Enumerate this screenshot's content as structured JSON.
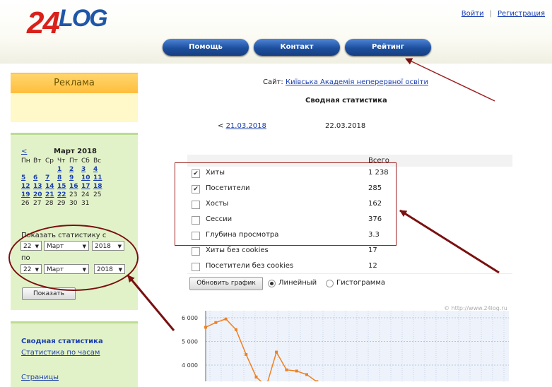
{
  "header": {
    "logo_digits": "24",
    "logo_text": "LOG",
    "login": "Войти",
    "separator": "|",
    "register": "Регистрация",
    "nav": [
      "Помощь",
      "Контакт",
      "Рейтинг"
    ]
  },
  "sidebar": {
    "ad_title": "Реклама",
    "calendar": {
      "prev": "<",
      "month": "Март 2018",
      "weekdays": [
        "Пн",
        "Вт",
        "Ср",
        "Чт",
        "Пт",
        "Сб",
        "Вс"
      ],
      "weeks": [
        [
          "",
          "",
          "",
          "1",
          "2",
          "3",
          "4"
        ],
        [
          "5",
          "6",
          "7",
          "8",
          "9",
          "10",
          "11"
        ],
        [
          "12",
          "13",
          "14",
          "15",
          "16",
          "17",
          "18"
        ],
        [
          "19",
          "20",
          "21",
          "22",
          "23",
          "24",
          "25"
        ],
        [
          "26",
          "27",
          "28",
          "29",
          "30",
          "31",
          ""
        ]
      ],
      "linked_max": 22
    },
    "show_stats_label": "Показать статистику с",
    "to_label": "по",
    "from": {
      "day": "22",
      "month": "Март",
      "year": "2018"
    },
    "to": {
      "day": "22",
      "month": "Март",
      "year": "2018"
    },
    "show_button": "Показать",
    "nav_links": [
      "Сводная статистика",
      "Статистика по часам",
      "Страницы"
    ]
  },
  "main": {
    "site_label": "Сайт:",
    "site_name": "Київська Академія неперервної освіти",
    "page_title": "Сводная статистика",
    "prev_date": "21.03.2018",
    "prev_prefix": "<",
    "current_date": "22.03.2018",
    "total_header": "Всего",
    "rows": [
      {
        "name": "Хиты",
        "value": "1 238",
        "checked": true
      },
      {
        "name": "Посетители",
        "value": "285",
        "checked": true
      },
      {
        "name": "Хосты",
        "value": "162",
        "checked": false
      },
      {
        "name": "Сессии",
        "value": "376",
        "checked": false
      },
      {
        "name": "Глубина просмотра",
        "value": "3.3",
        "checked": false
      },
      {
        "name": "Хиты без cookies",
        "value": "17",
        "checked": false
      },
      {
        "name": "Посетители без cookies",
        "value": "12",
        "checked": false
      }
    ],
    "redraw_button": "Обновить график",
    "radio_line": "Линейный",
    "radio_hist": "Гистограмма",
    "watermark": "© http://www.24log.ru"
  },
  "colors": {
    "accent_red": "#9c2020",
    "chart_line": "#f08020",
    "nav_blue": "#1d4f9e",
    "sidebar_green": "#e2f2c8"
  },
  "chart_data": {
    "type": "line",
    "ylim": [
      3600,
      6000
    ],
    "yticks": [
      "6 000",
      "5 000",
      "4 000"
    ],
    "y_tick_values": [
      6000,
      5000,
      4000
    ],
    "series": [
      {
        "values": [
          5600,
          5800,
          5950,
          5500,
          4450,
          3500,
          3100,
          4550,
          3800,
          3750,
          3600,
          3300
        ]
      }
    ]
  }
}
